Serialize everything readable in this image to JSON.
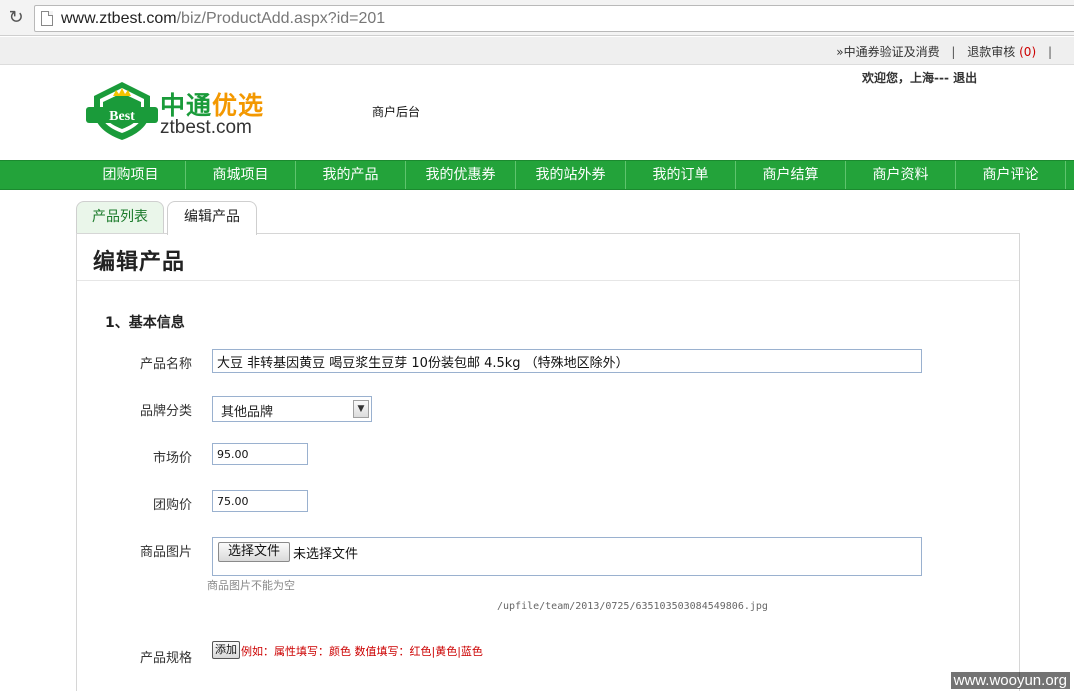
{
  "browser": {
    "url_host": "www.ztbest.com",
    "url_rest": "/biz/ProductAdd.aspx?id=201"
  },
  "toplinks": {
    "verify": "»中通券验证及消费",
    "refund": "退款审核",
    "refund_count": "(0)",
    "sep": "|"
  },
  "header": {
    "logo_cn_part1": "中通",
    "logo_cn_part2": "优选",
    "logo_badge": "Best",
    "logo_en": "ztbest.com",
    "backend_title": "商户后台",
    "welcome": "欢迎您，上海--- 退出"
  },
  "nav": {
    "items": [
      "团购项目",
      "商城项目",
      "我的产品",
      "我的优惠券",
      "我的站外券",
      "我的订单",
      "商户结算",
      "商户资料",
      "商户评论"
    ]
  },
  "tabs": {
    "list": "产品列表",
    "edit": "编辑产品"
  },
  "form": {
    "page_title": "编辑产品",
    "section_title": "1、基本信息",
    "name_label": "产品名称",
    "name_value": "大豆 非转基因黄豆 喝豆浆生豆芽 10份装包邮 4.5kg （特殊地区除外）",
    "brand_label": "品牌分类",
    "brand_value": "其他品牌",
    "market_price_label": "市场价",
    "market_price_value": "95.00",
    "group_price_label": "团购价",
    "group_price_value": "75.00",
    "image_label": "商品图片",
    "file_button": "选择文件",
    "file_status": "未选择文件",
    "image_hint": "商品图片不能为空",
    "image_path": "/upfile/team/2013/0725/635103503084549806.jpg",
    "spec_label": "产品规格",
    "add_button": "添加",
    "spec_example": "例如：属性填写：颜色 数值填写：红色|黄色|蓝色"
  },
  "watermark": "www.wooyun.org",
  "colors": {
    "brand_green": "#23a33a",
    "brand_orange": "#f39800",
    "alert_red": "#cc0000"
  }
}
